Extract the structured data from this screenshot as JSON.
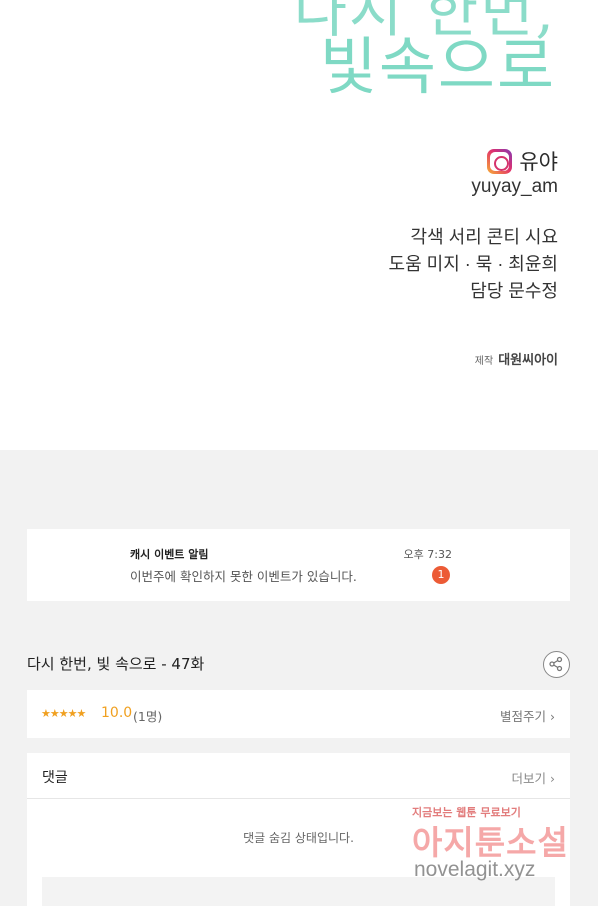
{
  "credits": {
    "title_line1": "다시 한번,",
    "title_line2": "빛속으로",
    "author": "유야",
    "author_handle": "yuyay_am",
    "staff_line1": "각색 서리 콘티 시요",
    "staff_line2": "도움 미지 · 묵 · 최윤희",
    "staff_line3": "담당 문수정",
    "studio_label": "제작",
    "studio_name": "대원씨아이"
  },
  "notification": {
    "title": "캐시 이벤트 알림",
    "time": "오후 7:32",
    "message": "이번주에 확인하지 못한 이벤트가 있습니다.",
    "badge_count": "1"
  },
  "episode": {
    "title": "다시 한번, 빛 속으로 - 47화"
  },
  "rating": {
    "stars": "★★★★★",
    "score": "10.0",
    "count": "(1명)",
    "rate_button": "별점주기 ›",
    "star_color": "#f0a020"
  },
  "comments": {
    "title": "댓글",
    "more": "더보기 ›",
    "hidden_message": "댓글 숨김 상태입니다."
  },
  "watermark": {
    "line1": "지금보는 웹툰 무료보기",
    "line2": "아지툰소설",
    "line3": "novelagit.xyz"
  },
  "icons": {
    "author": "instagram-icon",
    "share": "share-icon"
  }
}
